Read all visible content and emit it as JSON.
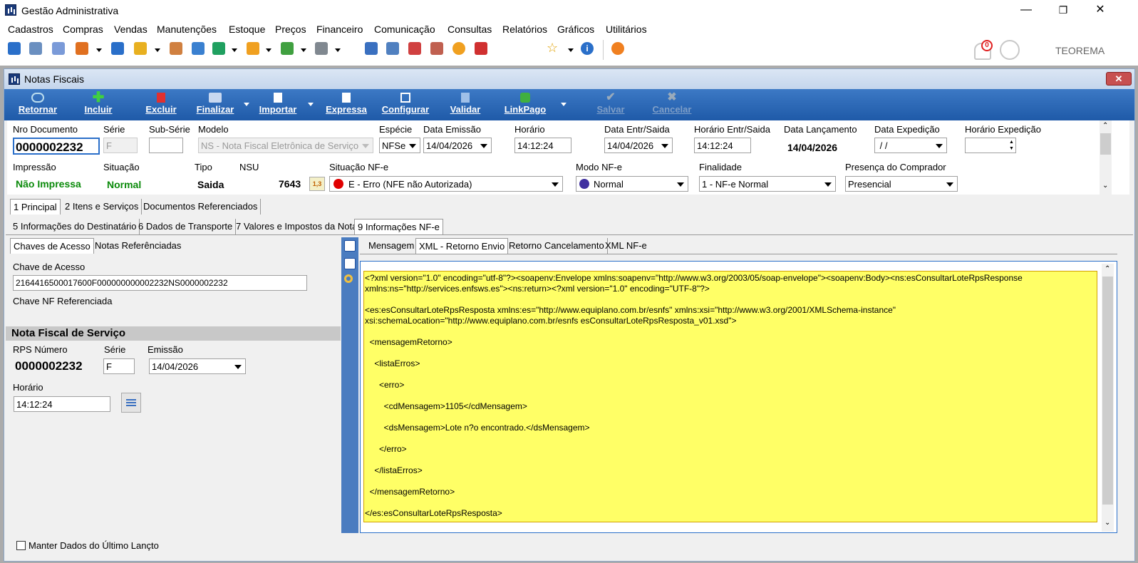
{
  "window": {
    "title": "Gestão Administrativa",
    "min": "—",
    "max": "❐",
    "close": "✕"
  },
  "menu": [
    "Cadastros",
    "Compras",
    "Vendas",
    "Manutenções",
    "Estoque",
    "Preços",
    "Financeiro",
    "Comunicação",
    "Consultas",
    "Relatórios",
    "Gráficos",
    "Utilitários"
  ],
  "toolbar": {
    "notif_count": "0",
    "user": "TEOREMA"
  },
  "child": {
    "title": "Notas Fiscais",
    "close": "✕"
  },
  "ribbon": [
    "Retornar",
    "Incluir",
    "Excluir",
    "Finalizar",
    "Importar",
    "Expressa",
    "Configurar",
    "Validar",
    "LinkPago",
    "Salvar",
    "Cancelar"
  ],
  "header": {
    "nro_documento_label": "Nro Documento",
    "nro_documento": "0000002232",
    "serie_label": "Série",
    "serie": "F",
    "subserie_label": "Sub-Série",
    "subserie": "",
    "modelo_label": "Modelo",
    "modelo": "NS - Nota Fiscal Eletrônica de Serviço",
    "especie_label": "Espécie",
    "especie": "NFSe",
    "data_emissao_label": "Data Emissão",
    "data_emissao": "14/04/2026",
    "horario_label": "Horário",
    "horario": "14:12:24",
    "data_entr_label": "Data Entr/Saida",
    "data_entr": "14/04/2026",
    "horario_entr_label": "Horário Entr/Saida",
    "horario_entr": "14:12:24",
    "data_lanc_label": "Data Lançamento",
    "data_lanc": "14/04/2026",
    "data_exp_label": "Data Expedição",
    "data_exp": " / /",
    "horario_exp_label": "Horário Expedição",
    "horario_exp": "",
    "impressao_label": "Impressão",
    "impressao": "Não Impressa",
    "situacao_label": "Situação",
    "situacao": "Normal",
    "tipo_label": "Tipo",
    "tipo": "Saida",
    "nsu_label": "NSU",
    "nsu": "7643",
    "sit_nfe_label": "Situação NF-e",
    "sit_nfe": "E - Erro (NFE não Autorizada)",
    "modo_label": "Modo NF-e",
    "modo": "Normal",
    "finalidade_label": "Finalidade",
    "finalidade": "1 - NF-e Normal",
    "presenca_label": "Presença do Comprador",
    "presenca": "Presencial",
    "status_color": "#e00000",
    "normal_color": "#0a8a0a"
  },
  "tabs1": [
    "1 Principal",
    "2 Itens e Serviços",
    "Documentos Referenciados"
  ],
  "tabs2": [
    "5 Informações do Destinatário",
    "6 Dados de Transporte",
    "7 Valores e Impostos da Nota",
    "9 Informações NF-e"
  ],
  "lefttabs": [
    "Chaves de Acesso",
    "Notas Referênciadas"
  ],
  "left": {
    "chave_label": "Chave de Acesso",
    "chave": "216441650001760­0F000000000002232NS0000002232",
    "chave_ref_label": "Chave NF Referenciada",
    "section": "Nota Fiscal de Serviço",
    "rps_label": "RPS Número",
    "rps": "0000002232",
    "serie_label": "Série",
    "serie": "F",
    "emissao_label": "Emissão",
    "emissao": "14/04/2026",
    "horario_label": "Horário",
    "horario": "14:12:24"
  },
  "righttabs": [
    "Mensagem",
    "XML - Retorno Envio",
    "Retorno Cancelamento",
    "XML NF-e"
  ],
  "xml": [
    "<?xml version=\"1.0\" encoding=\"utf-8\"?><soapenv:Envelope xmlns:soapenv=\"http://www.w3.org/2003/05/soap-envelope\"><soapenv:Body><ns:esConsultarLoteRpsResponse",
    "xmlns:ns=\"http://services.enfsws.es\"><ns:return><?xml version=\"1.0\" encoding=\"UTF-8\"?>",
    "",
    "<es:esConsultarLoteRpsResposta xmlns:es=\"http://www.equiplano.com.br/esnfs\" xmlns:xsi=\"http://www.w3.org/2001/XMLSchema-instance\"",
    "xsi:schemaLocation=\"http://www.equiplano.com.br/esnfs esConsultarLoteRpsResposta_v01.xsd\">",
    "",
    "  <mensagemRetorno>",
    "",
    "    <listaErros>",
    "",
    "      <erro>",
    "",
    "        <cdMensagem>1105</cdMensagem>",
    "",
    "        <dsMensagem>Lote n?o encontrado.</dsMensagem>",
    "",
    "      </erro>",
    "",
    "    </listaErros>",
    "",
    "  </mensagemRetorno>",
    "",
    "</es:esConsultarLoteRpsResposta>"
  ],
  "footer": {
    "manter": "Manter Dados do Último Lançto"
  }
}
